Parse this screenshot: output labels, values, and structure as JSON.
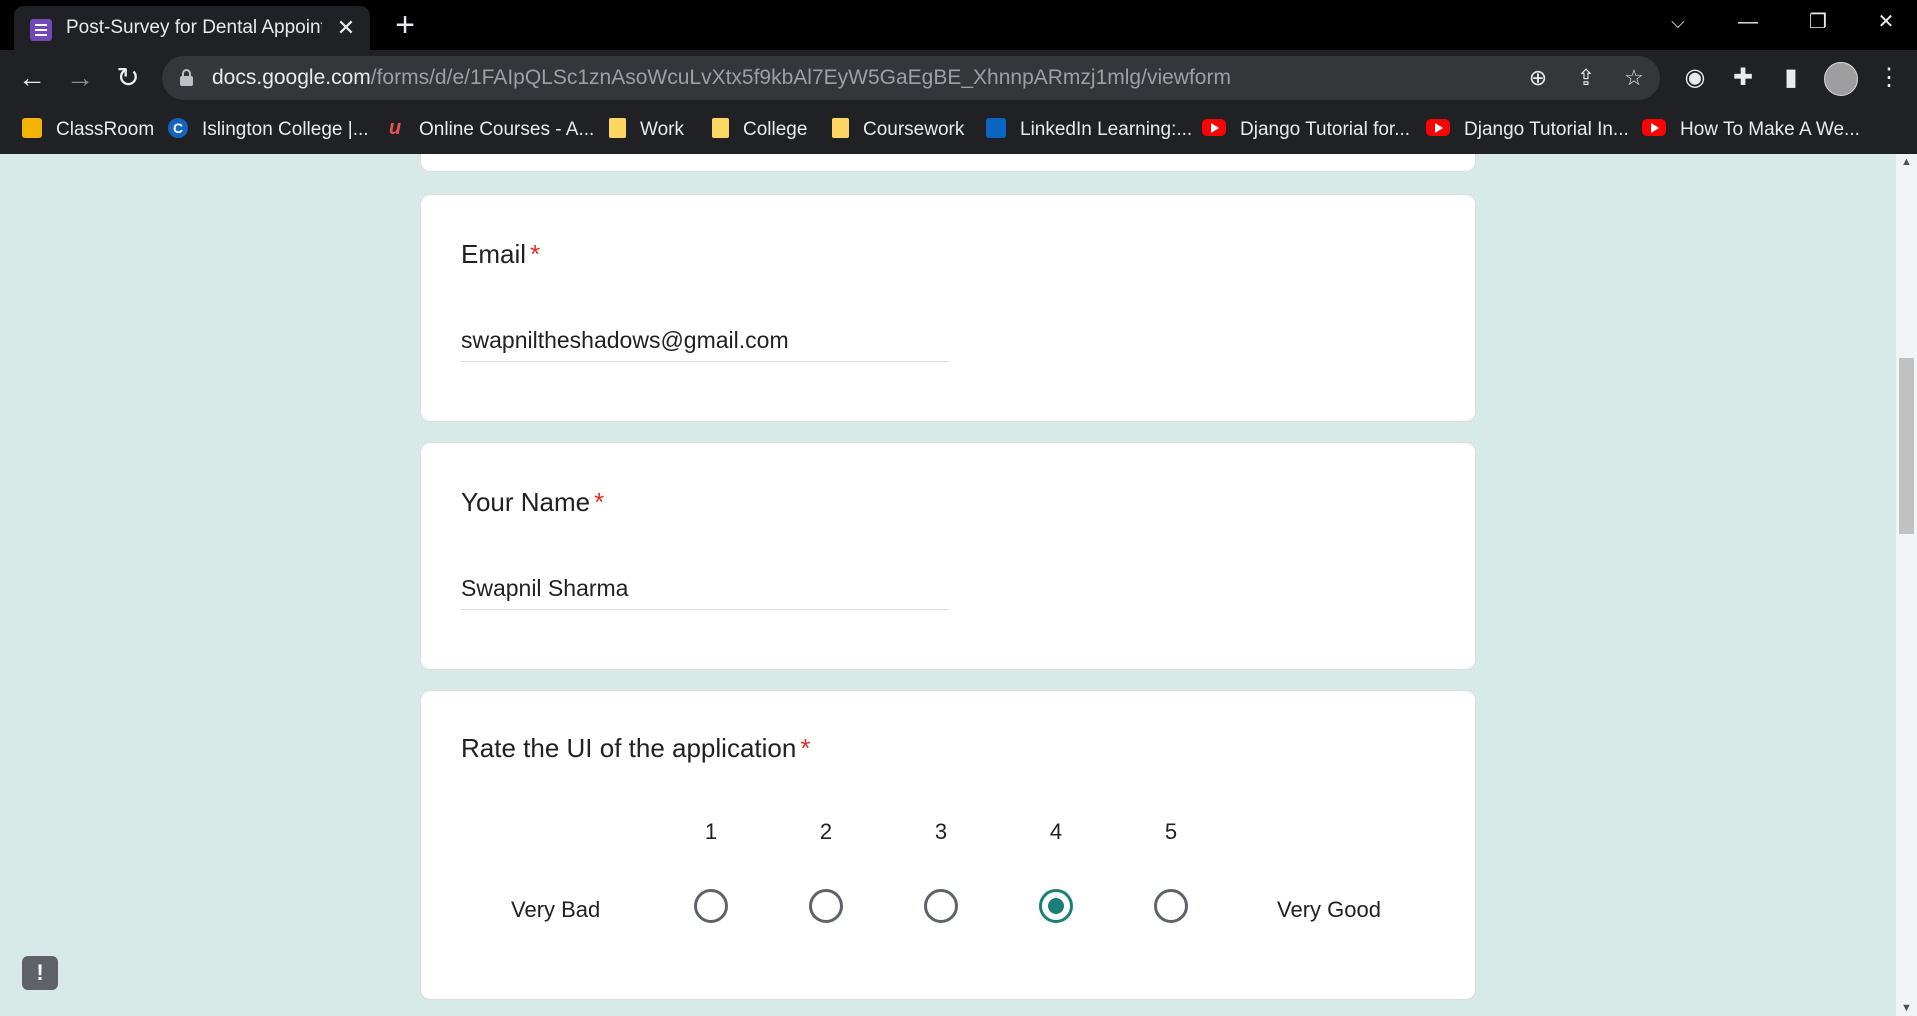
{
  "browser": {
    "tab_title": "Post-Survey for Dental Appointm",
    "url_host": "docs.google.com",
    "url_path": "/forms/d/e/1FAIpQLSc1znAsoWcuLvXtx5f9kbAl7EyW5GaEgBE_XhnnpARmzj1mlg/viewform"
  },
  "bookmarks": [
    {
      "label": "ClassRoom",
      "icon": "google-classroom-icon"
    },
    {
      "label": "Islington College |...",
      "icon": "islington-icon"
    },
    {
      "label": "Online Courses - A...",
      "icon": "udemy-icon"
    },
    {
      "label": "Work",
      "icon": "folder-icon"
    },
    {
      "label": "College",
      "icon": "folder-icon"
    },
    {
      "label": "Coursework",
      "icon": "folder-icon"
    },
    {
      "label": "LinkedIn Learning:...",
      "icon": "linkedin-learning-icon"
    },
    {
      "label": "Django Tutorial for...",
      "icon": "youtube-icon"
    },
    {
      "label": "Django Tutorial In...",
      "icon": "youtube-icon"
    },
    {
      "label": "How To Make A We...",
      "icon": "youtube-icon"
    }
  ],
  "form": {
    "required_mark": "*",
    "email": {
      "label": "Email",
      "value": "swapniltheshadows@gmail.com"
    },
    "name": {
      "label": "Your Name",
      "value": "Swapnil Sharma"
    },
    "rating": {
      "label": "Rate the UI of the application",
      "low_label": "Very Bad",
      "high_label": "Very Good",
      "options": [
        "1",
        "2",
        "3",
        "4",
        "5"
      ],
      "selected": "4"
    }
  },
  "colors": {
    "page_background": "#d8eae7",
    "accent": "#1a7f76",
    "required": "#d93025"
  }
}
